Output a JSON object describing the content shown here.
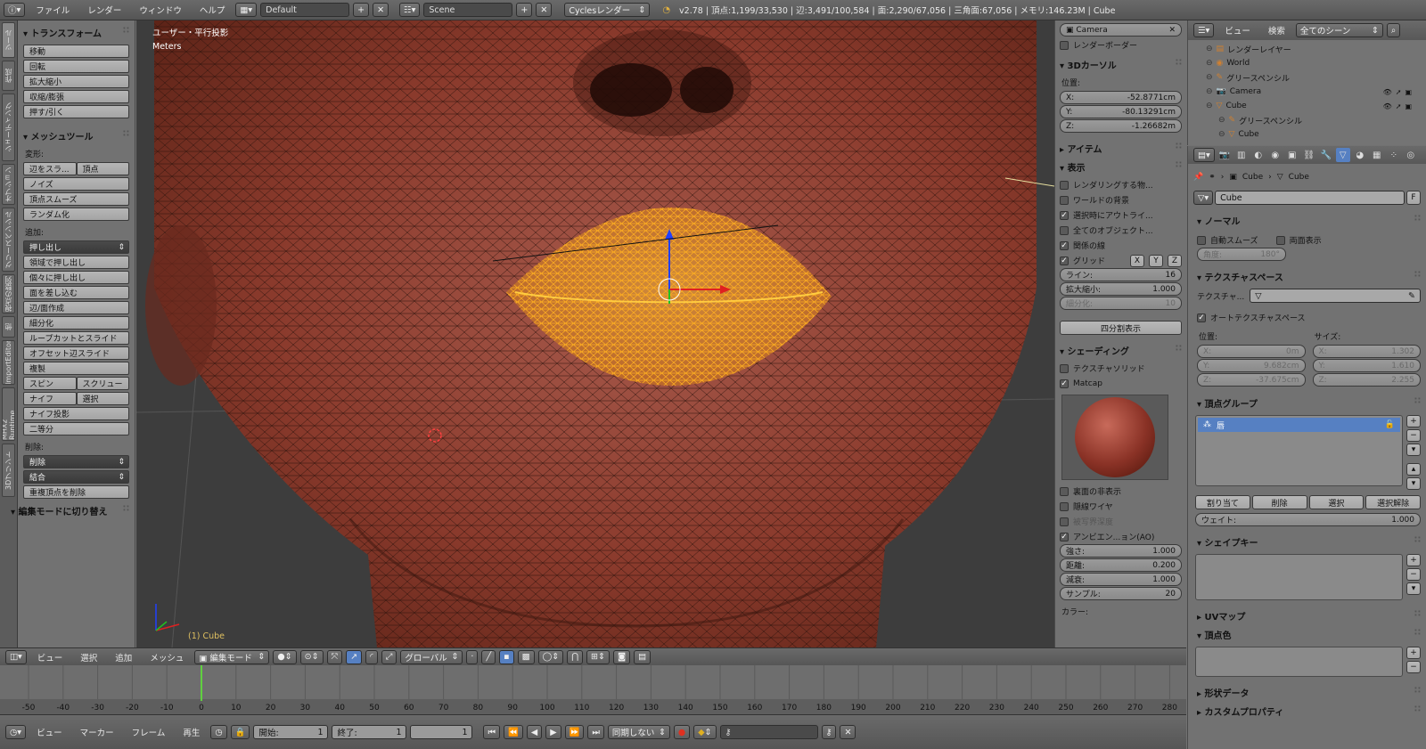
{
  "topbar": {
    "menus": [
      "ファイル",
      "レンダー",
      "ウィンドウ",
      "ヘルプ"
    ],
    "layout": "Default",
    "scene": "Scene",
    "engine": "Cyclesレンダー",
    "stats": "v2.78 | 頂点:1,199/33,530 | 辺:3,491/100,584 | 面:2,290/67,056 | 三角面:67,056 | メモリ:146.23M | Cube"
  },
  "tabs": [
    "ツール",
    "作成",
    "シェーディング",
    "オプション",
    "グリースペンシル",
    "視点の整列",
    "ImportEditor",
    "MHX2 Runtime",
    "3Dプリント"
  ],
  "tool_shelf": {
    "transform_title": "トランスフォーム",
    "transform": [
      "移動",
      "回転",
      "拡大縮小",
      "収縮/膨張",
      "押す/引く"
    ],
    "mesh_title": "メッシュツール",
    "deform_label": "変形:",
    "slide_left": "辺をスラ...",
    "slide_right": "頂点",
    "deform": [
      "ノイズ",
      "頂点スムーズ",
      "ランダム化"
    ],
    "add_label": "追加:",
    "extrude_select": "押し出し",
    "add": [
      "領域で押し出し",
      "個々に押し出し",
      "面を差し込む",
      "辺/面作成",
      "細分化",
      "ループカットとスライド",
      "オフセット辺スライド",
      "複製"
    ],
    "spin": "スピン",
    "screw": "スクリュー",
    "knife": "ナイフ",
    "select": "選択",
    "add2": [
      "ナイフ投影",
      "二等分"
    ],
    "remove_label": "削除:",
    "delete_select": "削除",
    "merge_select": "結合",
    "remove_doubles": "重複頂点を削除",
    "editmode_title": "編集モードに切り替え"
  },
  "viewport": {
    "view_name": "ユーザー・平行投影",
    "units": "Meters",
    "object_label": "(1) Cube"
  },
  "npanel": {
    "camera_field": "Camera",
    "render_border": "レンダーボーダー",
    "cursor_title": "3Dカーソル",
    "location_label": "位置:",
    "cursor": [
      {
        "axis": "X:",
        "value": "-52.8771cm"
      },
      {
        "axis": "Y:",
        "value": "-80.13291cm"
      },
      {
        "axis": "Z:",
        "value": "-1.26682m"
      }
    ],
    "item_title": "アイテム",
    "display_title": "表示",
    "display_checks": [
      {
        "label": "レンダリングする物...",
        "checked": false
      },
      {
        "label": "ワールドの背景",
        "checked": false
      },
      {
        "label": "選択時にアウトライ...",
        "checked": true
      },
      {
        "label": "全てのオブジェクト...",
        "checked": false
      },
      {
        "label": "関係の線",
        "checked": true
      }
    ],
    "grid_label": "グリッド",
    "grid_axes": [
      "X",
      "Y",
      "Z"
    ],
    "grid_fields": [
      {
        "label": "ライン:",
        "value": "16"
      },
      {
        "label": "拡大縮小:",
        "value": "1.000"
      },
      {
        "label": "細分化:",
        "value": "10"
      }
    ],
    "quad_view": "四分割表示",
    "shading_title": "シェーディング",
    "texture_solid": "テクスチャソリッド",
    "matcap": "Matcap",
    "backface": "裏面の非表示",
    "hidden_wire": "隠線ワイヤ",
    "dof": "被写界深度",
    "ao": "アンビエン...ョン(AO)",
    "ao_fields": [
      {
        "label": "強さ:",
        "value": "1.000"
      },
      {
        "label": "距離:",
        "value": "0.200"
      },
      {
        "label": "減衰:",
        "value": "1.000"
      },
      {
        "label": "サンプル:",
        "value": "20"
      }
    ],
    "color_label": "カラー:"
  },
  "outliner": {
    "view": "ビュー",
    "search": "検索",
    "scope": "全てのシーン",
    "rows": [
      {
        "label": "レンダーレイヤー",
        "indent": 1
      },
      {
        "label": "World",
        "indent": 1
      },
      {
        "label": "グリースペンシル",
        "indent": 1
      },
      {
        "label": "Camera",
        "indent": 1
      },
      {
        "label": "Cube",
        "indent": 1
      },
      {
        "label": "グリースペンシル",
        "indent": 2
      },
      {
        "label": "Cube",
        "indent": 2
      }
    ]
  },
  "props": {
    "crumb_obj": "Cube",
    "crumb_mesh": "Cube",
    "mesh_name": "Cube",
    "fake_user": "F",
    "normals_title": "ノーマル",
    "auto_smooth": "自動スムーズ",
    "double_sided": "両面表示",
    "angle_label": "角度:",
    "angle_value": "180°",
    "texspace_title": "テクスチャスペース",
    "texspace_label": "テクスチャ...",
    "auto_texspace": "オートテクスチャスペース",
    "location_label": "位置:",
    "size_label": "サイズ:",
    "loc": [
      {
        "axis": "X:",
        "value": "0m"
      },
      {
        "axis": "Y:",
        "value": "9.682cm"
      },
      {
        "axis": "Z:",
        "value": "-37.675cm"
      }
    ],
    "size": [
      {
        "axis": "X:",
        "value": "1.302"
      },
      {
        "axis": "Y:",
        "value": "1.610"
      },
      {
        "axis": "Z:",
        "value": "2.255"
      }
    ],
    "vgroups_title": "頂点グループ",
    "vgroup_name": "唇",
    "vg_buttons": [
      "割り当て",
      "削除",
      "選択",
      "選択解除"
    ],
    "weight_label": "ウェイト:",
    "weight_value": "1.000",
    "shapekeys_title": "シェイプキー",
    "uvmaps_title": "UVマップ",
    "vcolors_title": "頂点色",
    "geometry_title": "形状データ",
    "custom_title": "カスタムプロパティ"
  },
  "vp_header": {
    "menus": [
      "ビュー",
      "選択",
      "追加",
      "メッシュ"
    ],
    "mode": "編集モード",
    "orientation": "グローバル"
  },
  "timeline": {
    "ticks": [
      "-50",
      "-40",
      "-30",
      "-20",
      "-10",
      "0",
      "10",
      "20",
      "30",
      "40",
      "50",
      "60",
      "70",
      "80",
      "90",
      "100",
      "110",
      "120",
      "130",
      "140",
      "150",
      "160",
      "170",
      "180",
      "190",
      "200",
      "210",
      "220",
      "230",
      "240",
      "250",
      "260",
      "270",
      "280"
    ],
    "current_frame": 0
  },
  "tl_header": {
    "menus": [
      "ビュー",
      "マーカー",
      "フレーム",
      "再生"
    ],
    "start_label": "開始:",
    "start_value": "1",
    "end_label": "終了:",
    "end_value": "1",
    "current": "1",
    "sync": "同期しない"
  }
}
